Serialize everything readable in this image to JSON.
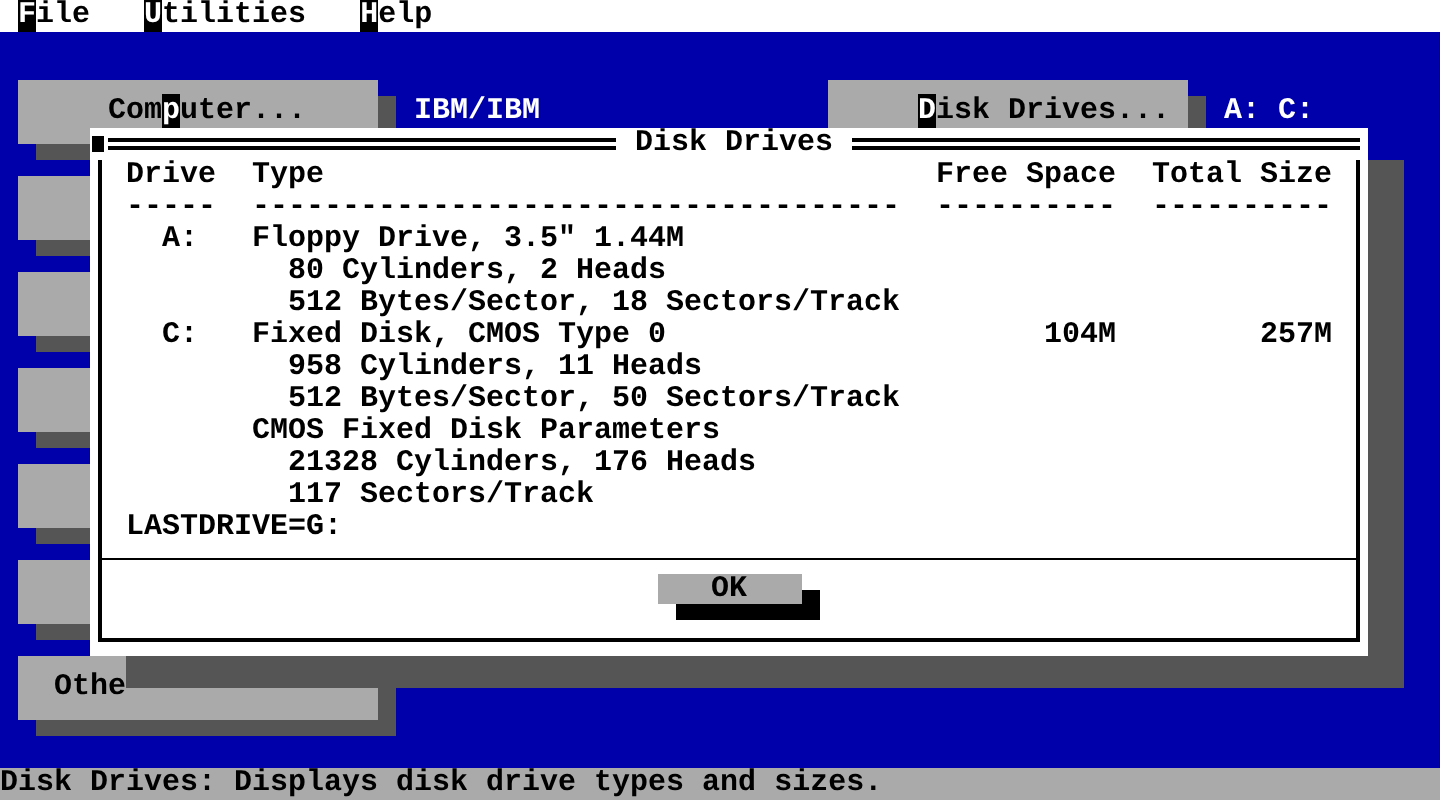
{
  "menu": [
    {
      "key": "F",
      "after": "ile"
    },
    {
      "key": "U",
      "after": "tilities"
    },
    {
      "key": "H",
      "after": "elp"
    }
  ],
  "left_buttons": [
    {
      "kind": "labeled",
      "before": "Com",
      "key": "p",
      "after": "uter..."
    },
    {
      "kind": "covered"
    },
    {
      "kind": "covered"
    },
    {
      "kind": "covered"
    },
    {
      "kind": "covered"
    },
    {
      "kind": "covered"
    },
    {
      "kind": "labeled",
      "before": "Othe"
    }
  ],
  "computer_value": "IBM/IBM",
  "disk_button": {
    "key": "D",
    "after": "isk Drives..."
  },
  "disk_value": "A: C:",
  "dialog": {
    "title": "Disk Drives",
    "columns": [
      "Drive",
      "Type",
      "Free Space",
      "Total Size"
    ],
    "rules": [
      "-----",
      "------------------------------------",
      "----------",
      "----------"
    ],
    "rows": [
      {
        "kind": "drive",
        "drive": "A:",
        "type": "Floppy Drive, 3.5\" 1.44M"
      },
      {
        "kind": "detail",
        "text": "80 Cylinders, 2 Heads"
      },
      {
        "kind": "detail",
        "text": "512 Bytes/Sector, 18 Sectors/Track"
      },
      {
        "kind": "drive",
        "drive": "C:",
        "type": "Fixed Disk, CMOS Type 0",
        "free": "104M",
        "total": "257M"
      },
      {
        "kind": "detail",
        "text": "958 Cylinders, 11 Heads"
      },
      {
        "kind": "detail",
        "text": "512 Bytes/Sector, 50 Sectors/Track"
      },
      {
        "kind": "heading",
        "text": "CMOS Fixed Disk Parameters"
      },
      {
        "kind": "detail",
        "text": "21328 Cylinders, 176 Heads"
      },
      {
        "kind": "detail",
        "text": "117 Sectors/Track"
      },
      {
        "kind": "note",
        "text": "LASTDRIVE=G:"
      }
    ],
    "ok": "OK"
  },
  "status_bar": "Disk Drives: Displays disk drive types and sizes."
}
